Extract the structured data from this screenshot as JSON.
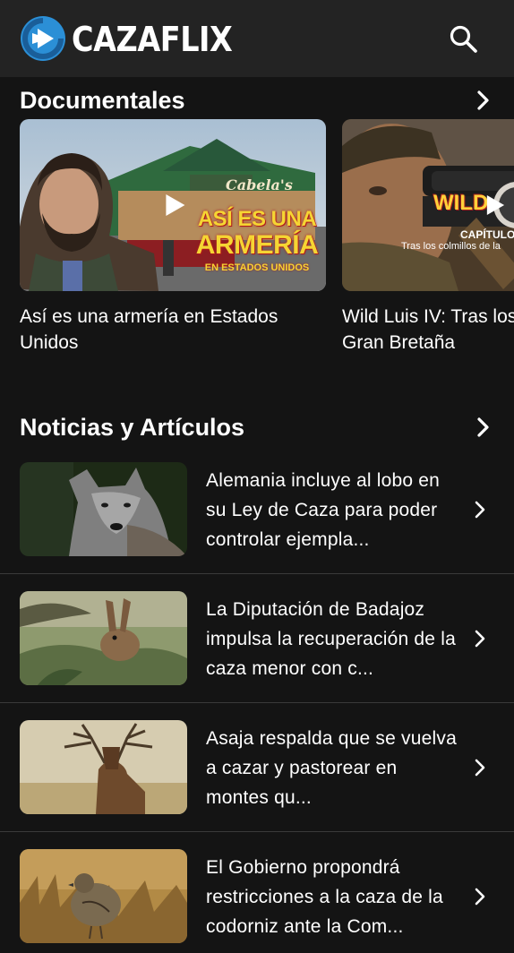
{
  "app": {
    "brand": "CAZAFLIX",
    "logo_icon": "play-logo-icon",
    "search_icon": "search-icon",
    "colors": {
      "background": "#141414",
      "topbar": "#232323",
      "logo_blue": "#2b8fd6",
      "text": "#ffffff",
      "divider": "#3a3a3a"
    }
  },
  "documentales": {
    "title": "Documentales",
    "cards": [
      {
        "title": "Así es una armería en Estados Unidos",
        "overlay_sign": "Cabela's",
        "overlay_line1": "ASÍ ES UNA",
        "overlay_line2": "ARMERÍA",
        "overlay_line3": "EN ESTADOS UNIDOS"
      },
      {
        "title": "Wild Luis IV: Tras los colmillos de la Gran Bretaña",
        "overlay_brand": "WILD",
        "overlay_chapter": "CAPÍTULO",
        "overlay_sub": "Tras los colmillos de la"
      }
    ]
  },
  "noticias": {
    "title": "Noticias y Artículos",
    "items": [
      {
        "title": "Alemania incluye al lobo en su Ley de Caza para poder controlar ejempla..."
      },
      {
        "title": "La Diputación de Badajoz impulsa la recuperación de la caza menor con c..."
      },
      {
        "title": "Asaja respalda que se vuelva a cazar y pastorear en montes qu..."
      },
      {
        "title": "El Gobierno propondrá restricciones a la caza de la codorniz ante la Com..."
      }
    ]
  }
}
